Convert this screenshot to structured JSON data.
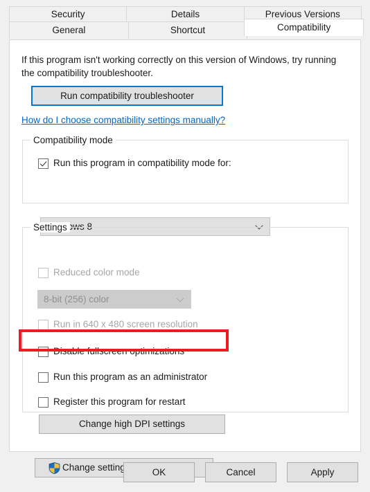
{
  "dialog": {
    "tabs_row1": [
      {
        "label": "Security",
        "active": false
      },
      {
        "label": "Details",
        "active": false
      },
      {
        "label": "Previous Versions",
        "active": false
      }
    ],
    "tabs_row2": [
      {
        "label": "General",
        "active": false
      },
      {
        "label": "Shortcut",
        "active": false
      },
      {
        "label": "Compatibility",
        "active": true
      }
    ]
  },
  "compatibility_page": {
    "intro_text": "If this program isn't working correctly on this version of Windows, try running the compatibility troubleshooter.",
    "troubleshooter_button": "Run compatibility troubleshooter",
    "help_link": "How do I choose compatibility settings manually?",
    "compatibility_mode": {
      "legend": "Compatibility mode",
      "checkbox_label": "Run this program in compatibility mode for:",
      "checkbox_checked": true,
      "os_value": "Windows 8"
    },
    "settings": {
      "legend": "Settings",
      "reduced_color_label": "Reduced color mode",
      "reduced_color_checked": false,
      "color_depth_value": "8-bit (256) color",
      "resolution_label": "Run in 640 x 480 screen resolution",
      "resolution_checked": false,
      "fullscreen_label": "Disable fullscreen optimizations",
      "fullscreen_checked": false,
      "admin_label": "Run this program as an administrator",
      "admin_checked": false,
      "register_label": "Register this program for restart",
      "register_checked": false,
      "dpi_button": "Change high DPI settings"
    },
    "all_users_button": "Change settings for all users"
  },
  "footer": {
    "ok": "OK",
    "cancel": "Cancel",
    "apply": "Apply"
  },
  "colors": {
    "accent_blue": "#0078d7",
    "link_blue": "#0066cc",
    "highlight_red": "#ee1b24",
    "dialog_bg": "#f0f0f0",
    "page_bg": "#ffffff",
    "button_bg": "#e1e1e1",
    "disabled_text": "#a6a6a6"
  }
}
